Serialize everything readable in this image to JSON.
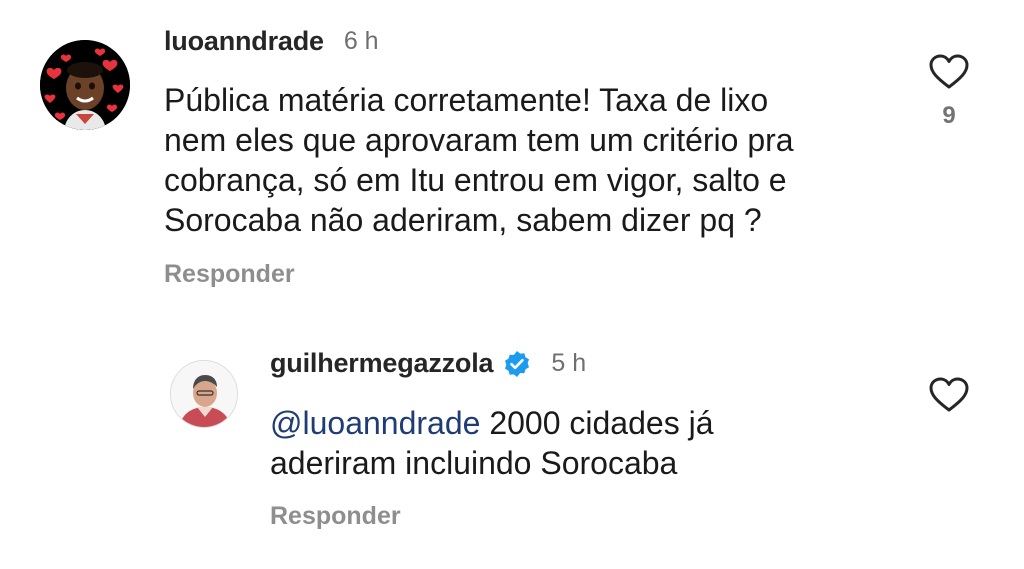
{
  "comments": [
    {
      "username": "luoanndrade",
      "time": "6 h",
      "text_lines": [
        "Pública matéria corretamente! Taxa de lixo",
        "nem eles que aprovaram tem um critério pra",
        "cobrança, só em Itu entrou em vigor, salto e",
        "Sorocaba não aderiram, sabem dizer pq ?"
      ],
      "reply_label": "Responder",
      "like_count": "9",
      "avatar_icon": "memoji-hearts-avatar",
      "avatar_bg": "#000000"
    },
    {
      "username": "guilhermegazzola",
      "verified": true,
      "time": "5 h",
      "mention": "@luoanndrade",
      "text_line1_rest": " 2000 cidades já",
      "text_line2": "aderiram incluindo Sorocaba",
      "reply_label": "Responder",
      "avatar_icon": "profile-photo-avatar"
    }
  ],
  "colors": {
    "verified_badge": "#1d9bf0",
    "mention": "#1f3d74",
    "heart_outline": "#262626",
    "muted_text": "#8e8e8e"
  }
}
